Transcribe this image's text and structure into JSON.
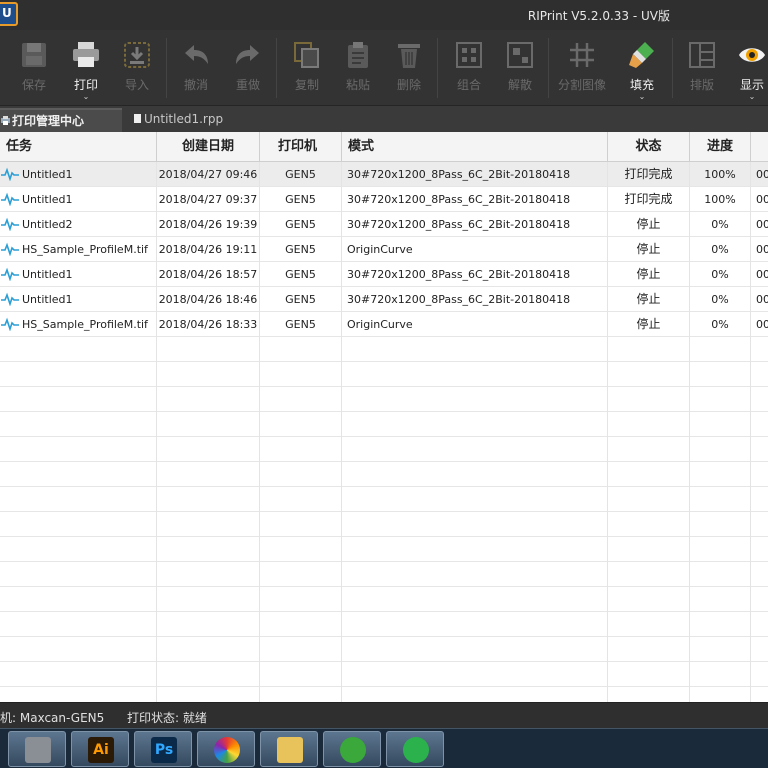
{
  "app": {
    "menu_button_glyph": "U",
    "window_title": "RIPrint V5.2.0.33 - UV版"
  },
  "toolbar": {
    "items": [
      {
        "label": "保存",
        "icon": "save-icon",
        "enabled": false
      },
      {
        "label": "打印",
        "icon": "printer-icon",
        "enabled": true,
        "has_dropdown": true
      },
      {
        "label": "导入",
        "icon": "import-icon",
        "enabled": false
      },
      {
        "label": "撤消",
        "icon": "undo-icon",
        "enabled": false
      },
      {
        "label": "重做",
        "icon": "redo-icon",
        "enabled": false
      },
      {
        "label": "复制",
        "icon": "copy-icon",
        "enabled": false
      },
      {
        "label": "粘贴",
        "icon": "paste-icon",
        "enabled": false
      },
      {
        "label": "删除",
        "icon": "trash-icon",
        "enabled": false
      },
      {
        "label": "组合",
        "icon": "group-icon",
        "enabled": false
      },
      {
        "label": "解散",
        "icon": "ungroup-icon",
        "enabled": false
      },
      {
        "label": "分割图像",
        "icon": "grid-split-icon",
        "enabled": false
      },
      {
        "label": "填充",
        "icon": "fill-brush-icon",
        "enabled": true,
        "has_dropdown": true
      },
      {
        "label": "排版",
        "icon": "layout-icon",
        "enabled": false
      },
      {
        "label": "显示",
        "icon": "eye-icon",
        "enabled": true,
        "has_dropdown": true
      }
    ],
    "dropdown_caret": "⌄"
  },
  "tabs": [
    {
      "label": "打印管理中心",
      "active": true
    },
    {
      "label": "Untitled1.rpp",
      "active": false
    }
  ],
  "table": {
    "columns": [
      "任务",
      "创建日期",
      "打印机",
      "模式",
      "状态",
      "进度"
    ],
    "rows": [
      {
        "task": "Untitled1",
        "date": "2018/04/27 09:46",
        "printer": "GEN5",
        "mode": "30#720x1200_8Pass_6C_2Bit-20180418",
        "status": "打印完成",
        "progress": "100%",
        "extra": "00"
      },
      {
        "task": "Untitled1",
        "date": "2018/04/27 09:37",
        "printer": "GEN5",
        "mode": "30#720x1200_8Pass_6C_2Bit-20180418",
        "status": "打印完成",
        "progress": "100%",
        "extra": "00"
      },
      {
        "task": "Untitled2",
        "date": "2018/04/26 19:39",
        "printer": "GEN5",
        "mode": "30#720x1200_8Pass_6C_2Bit-20180418",
        "status": "停止",
        "progress": "0%",
        "extra": "00"
      },
      {
        "task": "HS_Sample_ProfileM.tif",
        "date": "2018/04/26 19:11",
        "printer": "GEN5",
        "mode": "OriginCurve",
        "status": "停止",
        "progress": "0%",
        "extra": "00"
      },
      {
        "task": "Untitled1",
        "date": "2018/04/26 18:57",
        "printer": "GEN5",
        "mode": "30#720x1200_8Pass_6C_2Bit-20180418",
        "status": "停止",
        "progress": "0%",
        "extra": "00"
      },
      {
        "task": "Untitled1",
        "date": "2018/04/26 18:46",
        "printer": "GEN5",
        "mode": "30#720x1200_8Pass_6C_2Bit-20180418",
        "status": "停止",
        "progress": "0%",
        "extra": "00"
      },
      {
        "task": "HS_Sample_ProfileM.tif",
        "date": "2018/04/26 18:33",
        "printer": "GEN5",
        "mode": "OriginCurve",
        "status": "停止",
        "progress": "0%",
        "extra": "00"
      }
    ],
    "selected_row": 0
  },
  "statusbar": {
    "printer_text": "机: Maxcan-GEN5",
    "print_status_text": "打印状态: 就绪"
  },
  "taskbar": {
    "apps": [
      {
        "icon": "printer-app-icon",
        "color": "#8a8f96"
      },
      {
        "icon": "illustrator-icon",
        "text": "Ai",
        "color": "#2b1a05",
        "text_color": "#ff9a00"
      },
      {
        "icon": "photoshop-icon",
        "text": "Ps",
        "color": "#0b2a4a",
        "text_color": "#31a8ff"
      },
      {
        "icon": "color-wheel-icon",
        "color": "#d93a7a"
      },
      {
        "icon": "file-explorer-icon",
        "color": "#e8c25a"
      },
      {
        "icon": "browser-icon",
        "color": "#3aa83a"
      },
      {
        "icon": "wechat-icon",
        "color": "#2bb24c"
      }
    ]
  }
}
